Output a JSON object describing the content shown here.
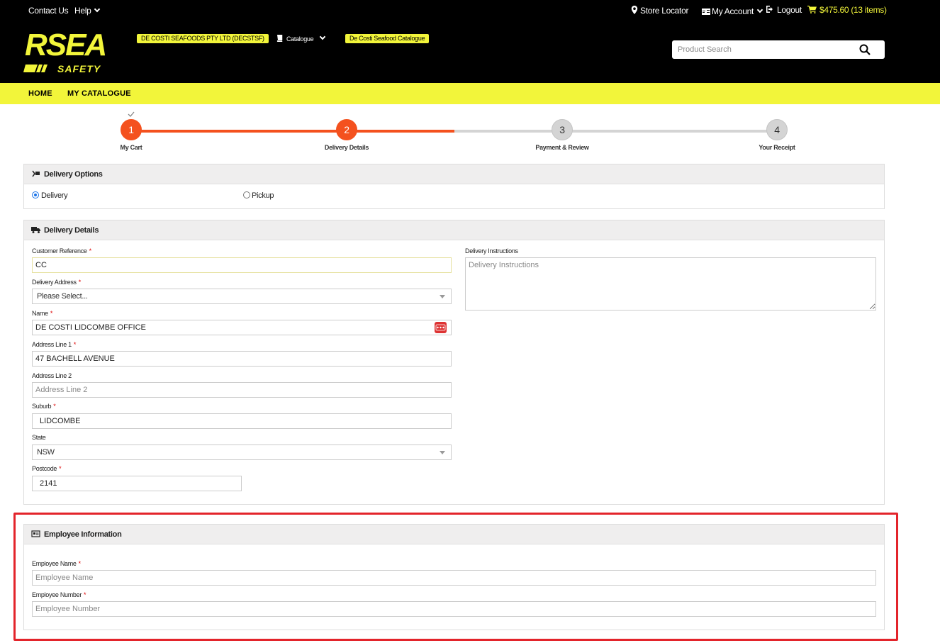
{
  "topbar": {
    "contact_us": "Contact Us",
    "help": "Help",
    "store_locator": "Store Locator",
    "my_account": "My Account",
    "logout": "Logout",
    "cart_total": "$475.60",
    "cart_items": "(13 items)"
  },
  "brand": {
    "logo_text": "RSEA",
    "logo_sub": "SAFETY",
    "accent": "#f2f53a"
  },
  "header": {
    "account_pill": "DE COSTI SEAFOODS PTY LTD (DECSTSF)",
    "catalogue_label": "Catalogue",
    "catalogue_pill": "De Costi Seafood Catalogue",
    "search_placeholder": "Product Search"
  },
  "nav": {
    "home": "HOME",
    "my_catalogue": "MY CATALOGUE"
  },
  "stepper": {
    "steps": [
      {
        "num": "1",
        "label": "My Cart",
        "state": "complete"
      },
      {
        "num": "2",
        "label": "Delivery Details",
        "state": "current"
      },
      {
        "num": "3",
        "label": "Payment & Review",
        "state": "pending"
      },
      {
        "num": "4",
        "label": "Your Receipt",
        "state": "pending"
      }
    ],
    "active_color": "#f4511e",
    "inactive_color": "#d4d4d4"
  },
  "delivery_options": {
    "title": "Delivery Options",
    "delivery_label": "Delivery",
    "pickup_label": "Pickup",
    "selected": "Delivery"
  },
  "delivery_details": {
    "title": "Delivery Details",
    "customer_reference_label": "Customer Reference",
    "customer_reference_value": "CC",
    "delivery_address_label": "Delivery Address",
    "delivery_address_value": "Please Select...",
    "name_label": "Name",
    "name_value": "DE COSTI LIDCOMBE OFFICE",
    "address1_label": "Address Line 1",
    "address1_value": "47 BACHELL AVENUE",
    "address2_label": "Address Line 2",
    "address2_placeholder": "Address Line 2",
    "suburb_label": "Suburb",
    "suburb_value": "LIDCOMBE",
    "state_label": "State",
    "state_value": "NSW",
    "postcode_label": "Postcode",
    "postcode_value": "2141",
    "instructions_label": "Delivery Instructions",
    "instructions_placeholder": "Delivery Instructions",
    "required_mark": "*"
  },
  "employee_info": {
    "title": "Employee Information",
    "name_label": "Employee Name",
    "name_placeholder": "Employee Name",
    "number_label": "Employee Number",
    "number_placeholder": "Employee Number",
    "required_mark": "*"
  }
}
